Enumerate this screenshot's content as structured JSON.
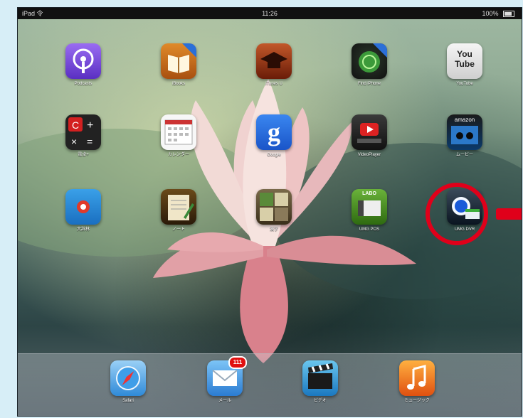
{
  "status": {
    "carrier": "iPad 令",
    "time": "11:26",
    "battery": "100%"
  },
  "apps": [
    {
      "id": "podcasts",
      "label": "Podcasts"
    },
    {
      "id": "ibooks",
      "label": "iBooks"
    },
    {
      "id": "itunes-u",
      "label": "iTunes U"
    },
    {
      "id": "find-iphone",
      "label": "Find iPhone"
    },
    {
      "id": "youtube",
      "label": "YouTube",
      "text": "You Tube"
    },
    {
      "id": "calculator",
      "label": "電卓+"
    },
    {
      "id": "calendar",
      "label": "カレンダー"
    },
    {
      "id": "google",
      "label": "Google",
      "text": "g"
    },
    {
      "id": "video-player",
      "label": "VideoPlayer"
    },
    {
      "id": "amazon",
      "label": "ムービー",
      "text": "amazon"
    },
    {
      "id": "dictionary",
      "label": "大辞林"
    },
    {
      "id": "notes",
      "label": "ノート"
    },
    {
      "id": "kanji",
      "label": "漢字"
    },
    {
      "id": "umg-pos",
      "label": "UMG POS",
      "text": "LABO"
    },
    {
      "id": "umg-dvr",
      "label": "UMG DVR"
    }
  ],
  "dock": [
    {
      "id": "safari",
      "label": "Safari"
    },
    {
      "id": "mail",
      "label": "メール",
      "badge": "111"
    },
    {
      "id": "videos",
      "label": "ビデオ"
    },
    {
      "id": "music",
      "label": "ミュージック"
    }
  ],
  "colors": {
    "highlight": "#e0001a",
    "badge": "#e01010"
  }
}
